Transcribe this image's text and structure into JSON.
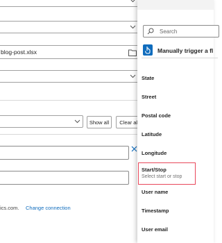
{
  "main": {
    "file_name": "blog-post.xlsx",
    "show_all_label": "Show all",
    "clear_all_label": "Clear all",
    "footer_text": "ics.com.",
    "change_connection_label": "Change connection"
  },
  "flyout": {
    "search_placeholder": "Search",
    "trigger_label": "Manually trigger a fl",
    "fields": [
      {
        "label": "State"
      },
      {
        "label": "Street"
      },
      {
        "label": "Postal code"
      },
      {
        "label": "Latitude"
      },
      {
        "label": "Longitude"
      },
      {
        "label": "Start/Stop",
        "sublabel": "Select start or stop",
        "highlighted": true
      },
      {
        "label": "User name"
      },
      {
        "label": "Timestamp"
      },
      {
        "label": "User email"
      }
    ]
  },
  "colors": {
    "accent": "#0f6cbd",
    "highlight_border": "#e8475a"
  }
}
